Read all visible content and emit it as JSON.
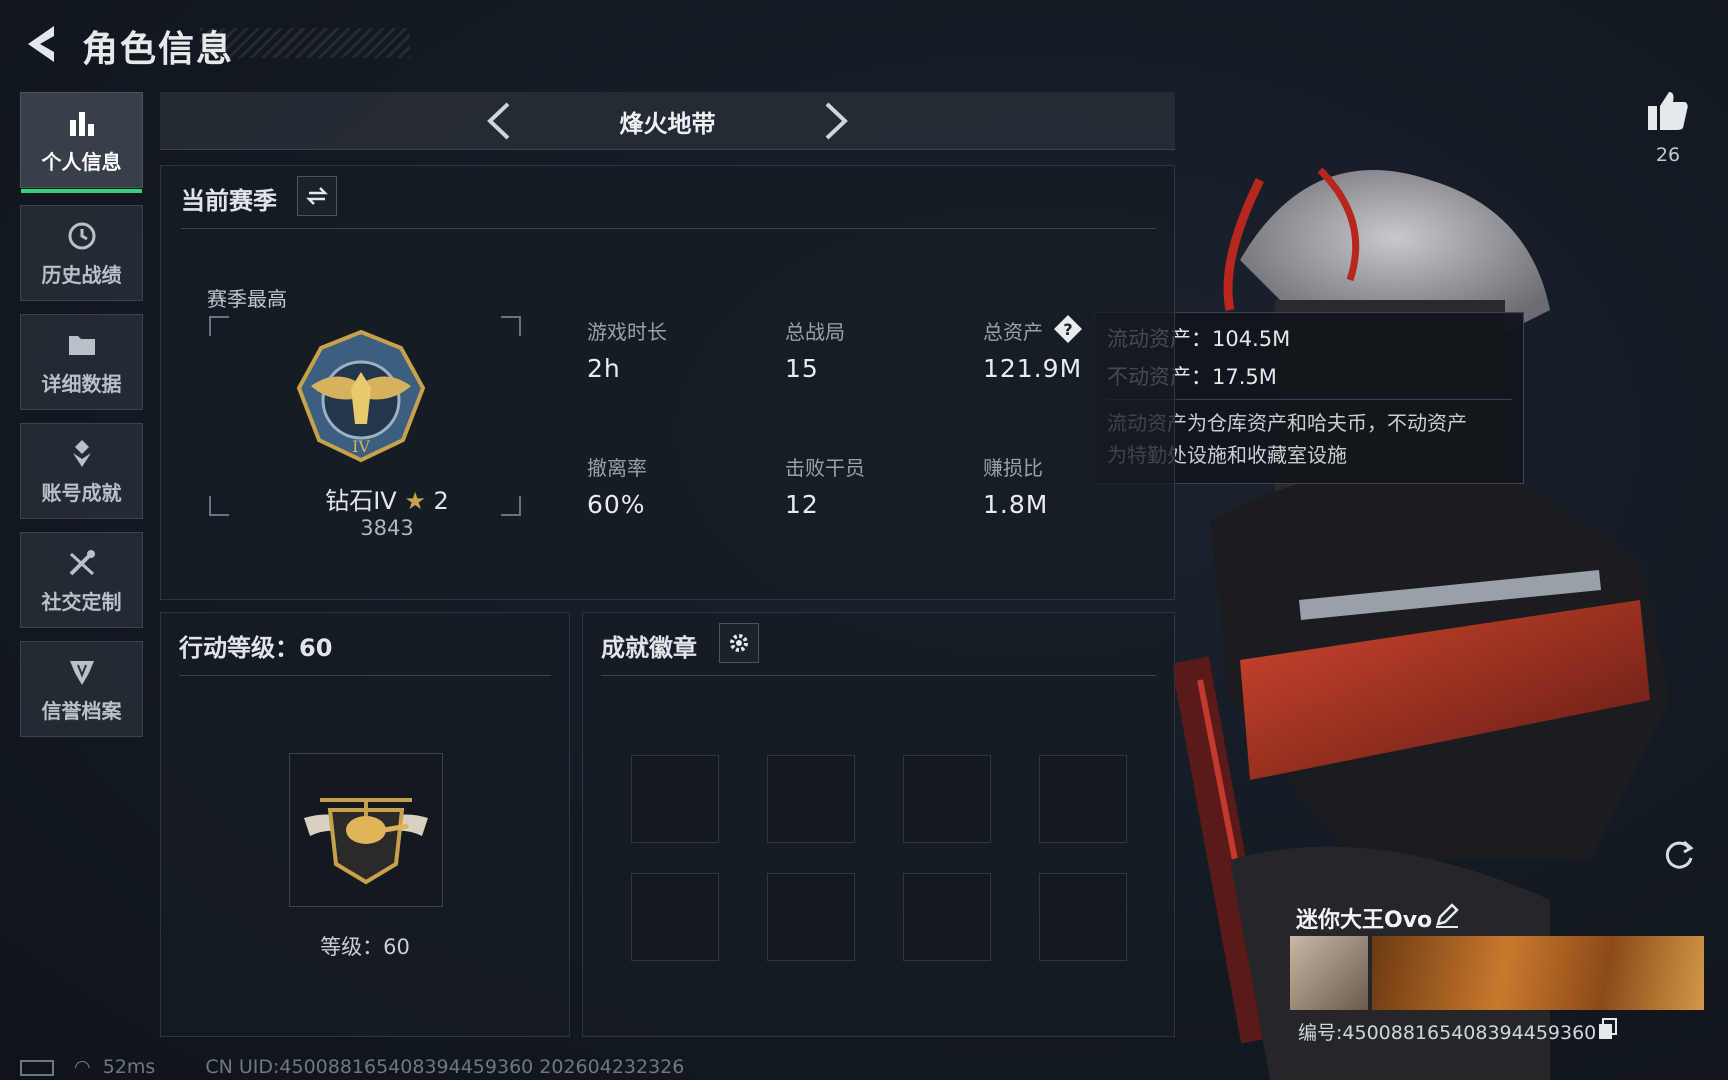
{
  "header": {
    "title": "角色信息"
  },
  "sidebar": {
    "items": [
      {
        "label": "个人信息",
        "icon": "bar-chart-icon"
      },
      {
        "label": "历史战绩",
        "icon": "history-clock-icon"
      },
      {
        "label": "详细数据",
        "icon": "folder-icon"
      },
      {
        "label": "账号成就",
        "icon": "achievement-icon"
      },
      {
        "label": "社交定制",
        "icon": "tools-icon"
      },
      {
        "label": "信誉档案",
        "icon": "shield-icon"
      }
    ]
  },
  "mode": {
    "title": "烽火地带"
  },
  "season": {
    "title": "当前赛季",
    "best_label": "赛季最高",
    "rank_name": "钻石IV",
    "rank_stars": "2",
    "rank_points": "3843",
    "stats": [
      {
        "label": "游戏时长",
        "value": "2h"
      },
      {
        "label": "总战局",
        "value": "15"
      },
      {
        "label": "总资产",
        "value": "121.9M"
      },
      {
        "label": "撤离率",
        "value": "60%"
      },
      {
        "label": "击败干员",
        "value": "12"
      },
      {
        "label": "赚损比",
        "value": "1.8M"
      }
    ]
  },
  "tooltip": {
    "liquid": "流动资产：104.5M",
    "fixed": "不动资产：17.5M",
    "desc1": "流动资产为仓库资产和哈夫币，不动资产",
    "desc2": "为特勤处设施和收藏室设施"
  },
  "action_level": {
    "title": "行动等级：60",
    "level_text": "等级：60"
  },
  "badges": {
    "title": "成就徽章"
  },
  "player": {
    "likes": "26",
    "name": "迷你大王Ovo",
    "id": "编号:450088165408394459360"
  },
  "status": {
    "ping": "52ms",
    "uid": "CN UID:450088165408394459360 202604232326"
  },
  "colors": {
    "accent_green": "#3ccf7a",
    "gold": "#c8a24a",
    "panel_bg": "#161c23"
  }
}
